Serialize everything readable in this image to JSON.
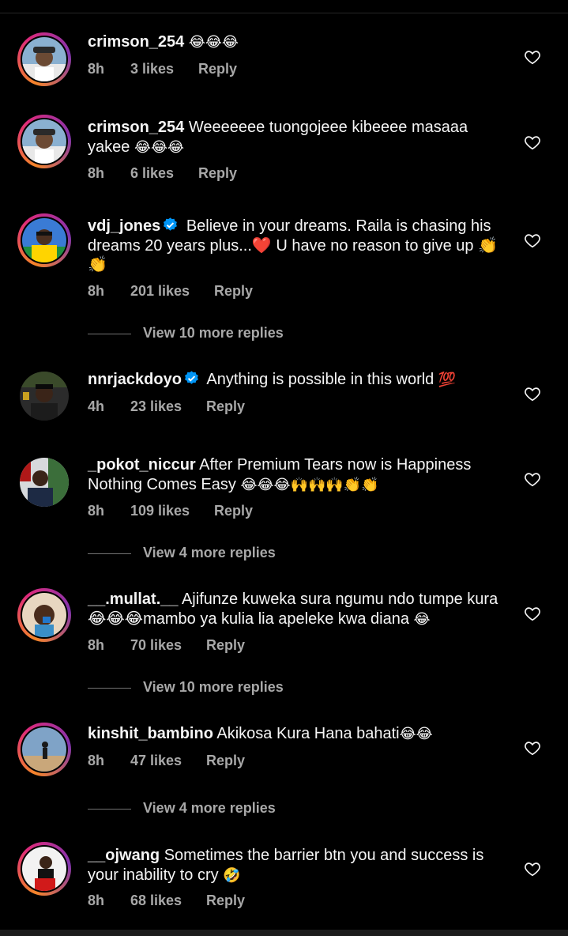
{
  "comments": [
    {
      "username": "crimson_254",
      "text": "",
      "emoji": "😂😂😂",
      "time": "8h",
      "likes": "3 likes",
      "reply": "Reply",
      "verified": false
    },
    {
      "username": "crimson_254",
      "text": "Weeeeeee tuongojeee kibeeee masaaa yakee",
      "emoji": "😂😂😂",
      "time": "8h",
      "likes": "6 likes",
      "reply": "Reply",
      "verified": false
    },
    {
      "username": "vdj_jones",
      "text": "Believe in your dreams. Raila is chasing his dreams 20 years plus...❤️ U have no reason to give up 👏👏",
      "emoji": "",
      "time": "8h",
      "likes": "201 likes",
      "reply": "Reply",
      "verified": true,
      "view_more": "View 10 more replies"
    },
    {
      "username": "nnrjackdoyo",
      "text": "Anything is possible in this world",
      "emoji": "💯",
      "time": "4h",
      "likes": "23 likes",
      "reply": "Reply",
      "verified": true
    },
    {
      "username": "_pokot_niccur",
      "text": "After Premium Tears now is Happiness Nothing Comes Easy",
      "emoji": "😂😂😂🙌🙌🙌👏👏",
      "time": "8h",
      "likes": "109 likes",
      "reply": "Reply",
      "verified": false,
      "view_more": "View 4 more replies"
    },
    {
      "username": "__.mullat.__",
      "text": "Ajifunze kuweka sura ngumu ndo tumpe kura 😂😂😂mambo ya kulia lia apeleke kwa diana",
      "emoji": "😂",
      "time": "8h",
      "likes": "70 likes",
      "reply": "Reply",
      "verified": false,
      "view_more": "View 10 more replies"
    },
    {
      "username": "kinshit_bambino",
      "text": "Akikosa Kura Hana bahati",
      "emoji": "😂😂",
      "time": "8h",
      "likes": "47 likes",
      "reply": "Reply",
      "verified": false,
      "view_more": "View 4 more replies"
    },
    {
      "username": "__ojwang",
      "text": "Sometimes the barrier btn you and success is your inability to cry",
      "emoji": "🤣",
      "time": "8h",
      "likes": "68 likes",
      "reply": "Reply",
      "verified": false
    }
  ],
  "icons": {
    "heart": "heart-outline-icon",
    "verified": "verified-badge-icon"
  },
  "colors": {
    "background": "#000000",
    "text": "#f5f5f5",
    "meta": "#a8a8a8",
    "verified": "#0095f6",
    "story_ring": "#dd2a7b"
  }
}
